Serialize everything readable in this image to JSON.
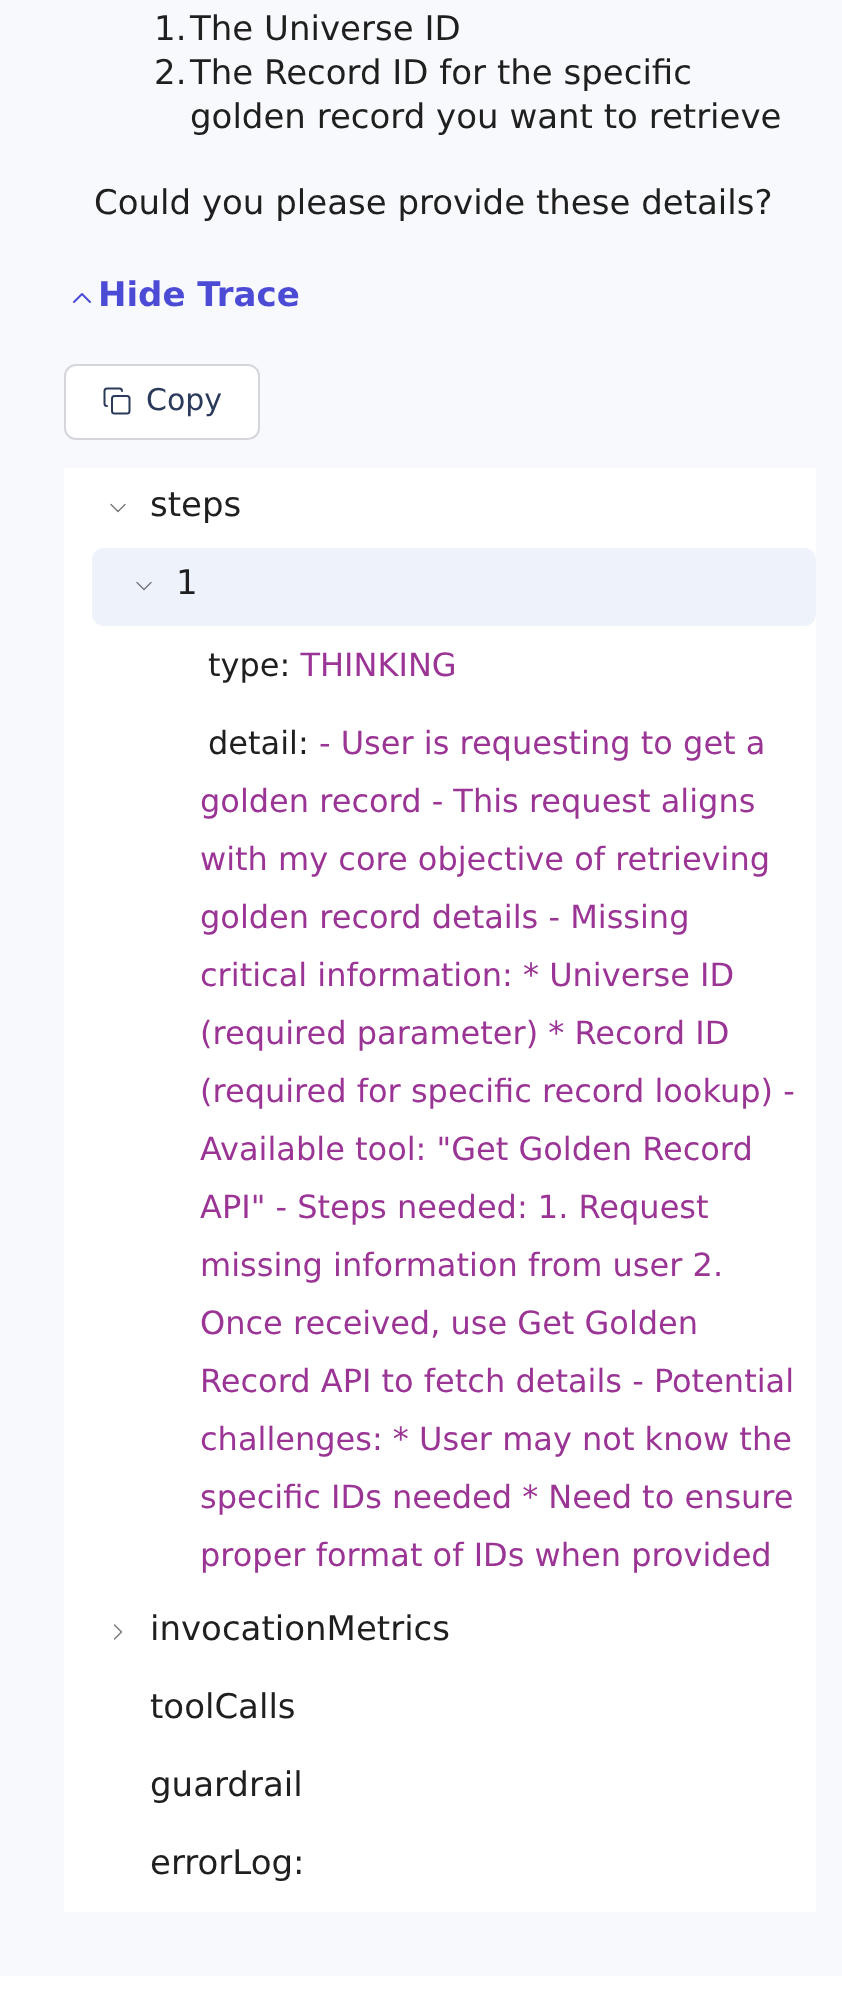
{
  "answer": {
    "list_items": [
      {
        "number": "1.",
        "text": "The Universe ID"
      },
      {
        "number": "2.",
        "text": "The Record ID for the specific golden record you want to retrieve"
      }
    ],
    "question": "Could you please provide these details?"
  },
  "trace_toggle": {
    "label": "Hide Trace",
    "expanded": true
  },
  "copy_button": {
    "label": "Copy"
  },
  "trace_tree": [
    {
      "kind": "branch",
      "key": "steps",
      "expanded": true,
      "selected": false,
      "children": [
        {
          "kind": "branch",
          "key": "1",
          "expanded": true,
          "selected": true,
          "children": [
            {
              "kind": "field",
              "key": "type:",
              "value": "THINKING"
            },
            {
              "kind": "field",
              "key": "detail:",
              "value": "- User is requesting to get a golden record - This request aligns with my core objective of retrieving golden record details - Missing critical information: * Universe ID (required parameter) * Record ID (required for specific record lookup) - Available tool: \"Get Golden Record API\" - Steps needed: 1. Request missing information from user 2. Once received, use Get Golden Record API to fetch details - Potential challenges: * User may not know the specific IDs needed * Need to ensure proper format of IDs when provided"
            }
          ]
        }
      ]
    },
    {
      "kind": "branch",
      "key": "invocationMetrics",
      "expanded": false,
      "selected": false
    },
    {
      "kind": "leaf",
      "key": "toolCalls",
      "selected": false
    },
    {
      "kind": "leaf",
      "key": "guardrail",
      "selected": false
    },
    {
      "kind": "leaf",
      "key": "errorLog:",
      "selected": false
    }
  ]
}
